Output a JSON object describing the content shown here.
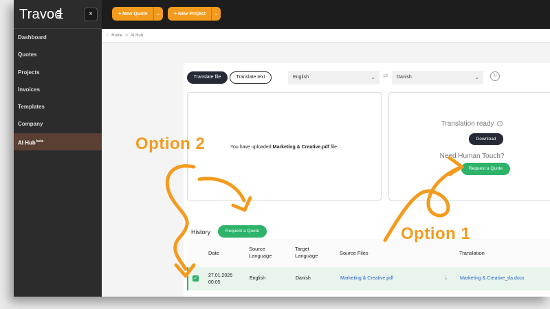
{
  "sidebar": {
    "logo": "Travod",
    "close_label": "×",
    "items": [
      {
        "label": "Dashboard"
      },
      {
        "label": "Quotes"
      },
      {
        "label": "Projects"
      },
      {
        "label": "Invoices"
      },
      {
        "label": "Templates"
      },
      {
        "label": "Company"
      },
      {
        "label": "AI Hub",
        "badge": "beta"
      }
    ],
    "active_item": "AI Hub"
  },
  "topbar": {
    "new_quote": "+ New Quote",
    "new_project": "+ New Project"
  },
  "breadcrumb": {
    "home": "Home",
    "separator": ">",
    "current": "AI Hub"
  },
  "translator": {
    "tab_file": "Translate file",
    "tab_text": "Translate text",
    "active_tab": "Translate file",
    "source_language": "English",
    "target_language": "Danish",
    "upload_msg_prefix": "You have uploaded ",
    "upload_filename": "Marketing & Creative.pdf",
    "upload_msg_suffix": " file.",
    "ready_title": "Translation ready",
    "download": "Download",
    "human_title": "Need Human Touch?",
    "request_quote": "Request a Quote"
  },
  "history": {
    "title": "History",
    "request_quote": "Request a Quote",
    "columns": [
      "Date",
      "Source\nLanguage",
      "Target\nLanguage",
      "Source Files",
      "Translation"
    ],
    "rows": [
      {
        "checked": true,
        "date": "27.01.2026",
        "time": "00:05",
        "source_language": "English",
        "target_language": "Danish",
        "source_file": "Marketing & Creative.pdf",
        "translation": "Marketing & Creative_da.docx"
      }
    ]
  },
  "annotations": {
    "option1": "Option 1",
    "option2": "Option 2"
  },
  "colors": {
    "accent": "#f39b1e",
    "green": "#2db36a",
    "sidebar": "#2c2c2c",
    "active_item": "#5a3f32",
    "dark_button": "#252a36",
    "link": "#2864c8"
  }
}
